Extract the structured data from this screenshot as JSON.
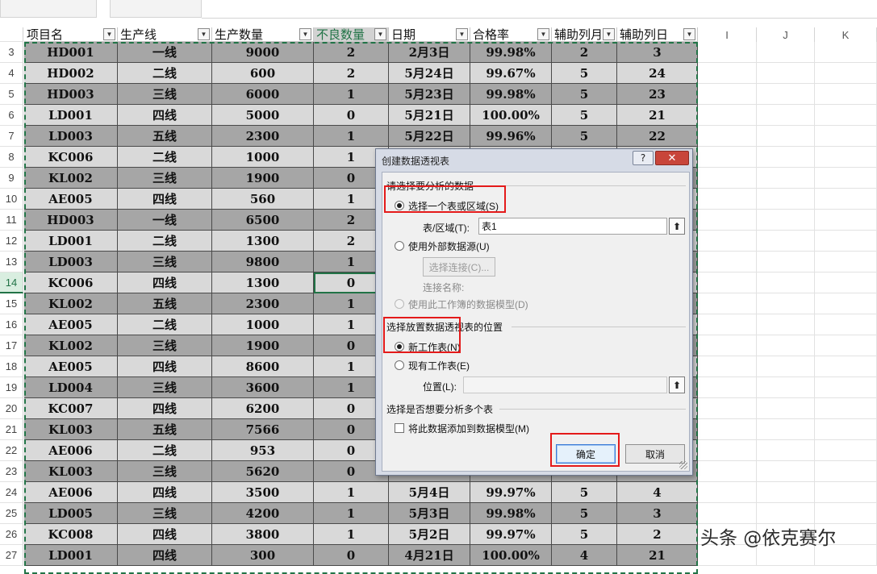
{
  "columns": {
    "letters": [
      "I",
      "J",
      "K"
    ],
    "headers": [
      "项目名",
      "生产线",
      "生产数量",
      "不良数量",
      "日期",
      "合格率",
      "辅助列月",
      "辅助列日"
    ]
  },
  "rows": [
    {
      "n": "3",
      "cells": [
        "HD001",
        "一线",
        "9000",
        "2",
        "2月3日",
        "99.98%",
        "2",
        "3"
      ]
    },
    {
      "n": "4",
      "cells": [
        "HD002",
        "二线",
        "600",
        "2",
        "5月24日",
        "99.67%",
        "5",
        "24"
      ]
    },
    {
      "n": "5",
      "cells": [
        "HD003",
        "三线",
        "6000",
        "1",
        "5月23日",
        "99.98%",
        "5",
        "23"
      ]
    },
    {
      "n": "6",
      "cells": [
        "LD001",
        "四线",
        "5000",
        "0",
        "5月21日",
        "100.00%",
        "5",
        "21"
      ]
    },
    {
      "n": "7",
      "cells": [
        "LD003",
        "五线",
        "2300",
        "1",
        "5月22日",
        "99.96%",
        "5",
        "22"
      ]
    },
    {
      "n": "8",
      "cells": [
        "KC006",
        "二线",
        "1000",
        "1",
        "",
        "",
        "",
        ""
      ]
    },
    {
      "n": "9",
      "cells": [
        "KL002",
        "三线",
        "1900",
        "0",
        "",
        "",
        "",
        ""
      ]
    },
    {
      "n": "10",
      "cells": [
        "AE005",
        "四线",
        "560",
        "1",
        "",
        "",
        "",
        ""
      ]
    },
    {
      "n": "11",
      "cells": [
        "HD003",
        "一线",
        "6500",
        "2",
        "",
        "",
        "",
        ""
      ]
    },
    {
      "n": "12",
      "cells": [
        "LD001",
        "二线",
        "1300",
        "2",
        "",
        "",
        "",
        ""
      ]
    },
    {
      "n": "13",
      "cells": [
        "LD003",
        "三线",
        "9800",
        "1",
        "",
        "",
        "",
        ""
      ]
    },
    {
      "n": "14",
      "cells": [
        "KC006",
        "四线",
        "1300",
        "0",
        "",
        "",
        "",
        ""
      ]
    },
    {
      "n": "15",
      "cells": [
        "KL002",
        "五线",
        "2300",
        "1",
        "",
        "",
        "",
        ""
      ]
    },
    {
      "n": "16",
      "cells": [
        "AE005",
        "二线",
        "1000",
        "1",
        "",
        "",
        "",
        ""
      ]
    },
    {
      "n": "17",
      "cells": [
        "KL002",
        "三线",
        "1900",
        "0",
        "",
        "",
        "",
        ""
      ]
    },
    {
      "n": "18",
      "cells": [
        "AE005",
        "四线",
        "8600",
        "1",
        "",
        "",
        "",
        ""
      ]
    },
    {
      "n": "19",
      "cells": [
        "LD004",
        "三线",
        "3600",
        "1",
        "",
        "",
        "",
        ""
      ]
    },
    {
      "n": "20",
      "cells": [
        "KC007",
        "四线",
        "6200",
        "0",
        "",
        "",
        "",
        ""
      ]
    },
    {
      "n": "21",
      "cells": [
        "KL003",
        "五线",
        "7566",
        "0",
        "",
        "",
        "",
        ""
      ]
    },
    {
      "n": "22",
      "cells": [
        "AE006",
        "二线",
        "953",
        "0",
        "",
        "",
        "",
        ""
      ]
    },
    {
      "n": "23",
      "cells": [
        "KL003",
        "三线",
        "5620",
        "0",
        "",
        "",
        "",
        ""
      ]
    },
    {
      "n": "24",
      "cells": [
        "AE006",
        "四线",
        "3500",
        "1",
        "5月4日",
        "99.97%",
        "5",
        "4"
      ]
    },
    {
      "n": "25",
      "cells": [
        "LD005",
        "三线",
        "4200",
        "1",
        "5月3日",
        "99.98%",
        "5",
        "3"
      ]
    },
    {
      "n": "26",
      "cells": [
        "KC008",
        "四线",
        "3800",
        "1",
        "5月2日",
        "99.97%",
        "5",
        "2"
      ]
    },
    {
      "n": "27",
      "cells": [
        "LD001",
        "四线",
        "300",
        "0",
        "4月21日",
        "100.00%",
        "4",
        "21"
      ]
    }
  ],
  "dialog": {
    "title": "创建数据透视表",
    "help_label": "?",
    "close_label": "✕",
    "section1": "请选择要分析的数据",
    "opt_table": "选择一个表或区域(S)",
    "range_label": "表/区域(T):",
    "range_value": "表1",
    "opt_external": "使用外部数据源(U)",
    "choose_conn": "选择连接(C)...",
    "conn_name": "连接名称:",
    "opt_model": "使用此工作簿的数据模型(D)",
    "section2": "选择放置数据透视表的位置",
    "opt_new": "新工作表(N)",
    "opt_existing": "现有工作表(E)",
    "location_label": "位置(L):",
    "location_value": "",
    "section3": "选择是否想要分析多个表",
    "add_model": "将此数据添加到数据模型(M)",
    "ok": "确定",
    "cancel": "取消"
  },
  "watermark": "头条 @依克赛尔"
}
